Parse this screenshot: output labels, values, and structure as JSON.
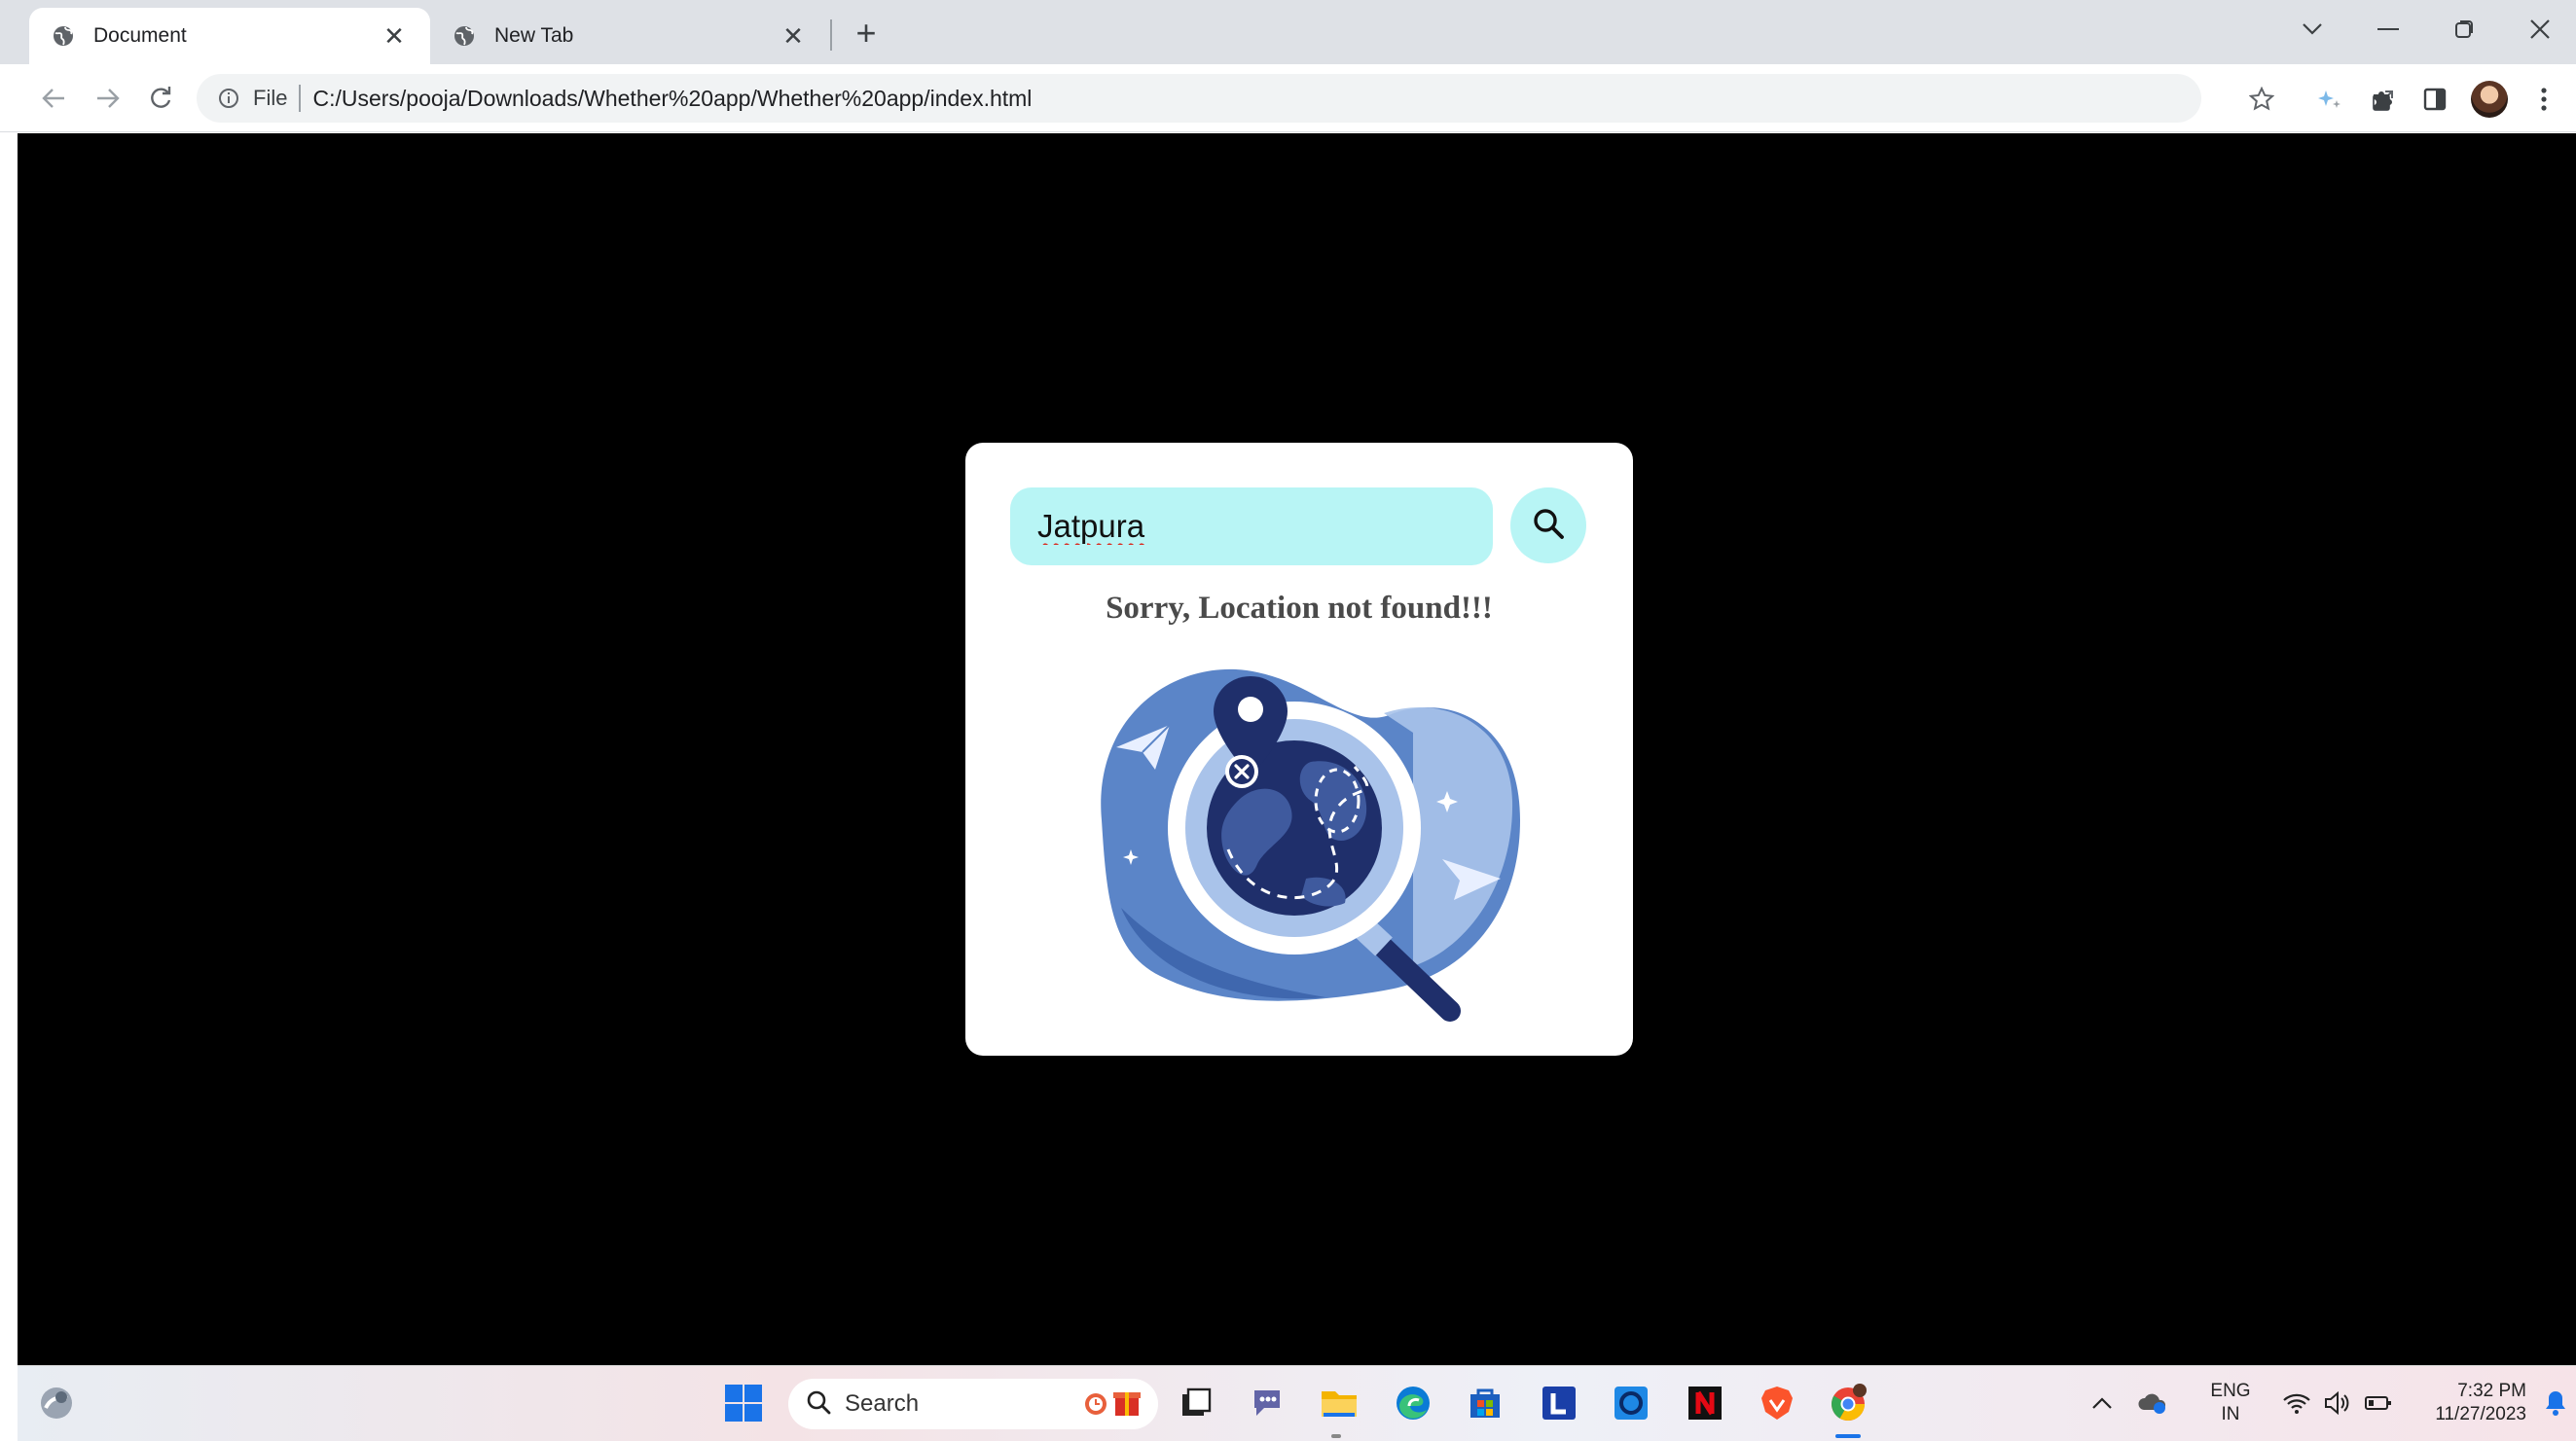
{
  "browser": {
    "tabs": [
      {
        "title": "Document",
        "active": true
      },
      {
        "title": "New Tab",
        "active": false
      }
    ],
    "address": {
      "scheme_label": "File",
      "url": "C:/Users/pooja/Downloads/Whether%20app/Whether%20app/index.html"
    }
  },
  "app": {
    "search": {
      "value": "Jatpura"
    },
    "message": "Sorry, Location not found!!!"
  },
  "taskbar": {
    "search_label": "Search",
    "language": {
      "line1": "ENG",
      "line2": "IN"
    },
    "clock": {
      "time": "7:32 PM",
      "date": "11/27/2023"
    }
  },
  "colors": {
    "page_bg": "#000000",
    "card_bg": "#ffffff",
    "search_bg": "#b8f5f5",
    "illustration_dark": "#1f2f6b",
    "illustration_mid": "#5b85c8",
    "illustration_light": "#a9c3ea"
  }
}
